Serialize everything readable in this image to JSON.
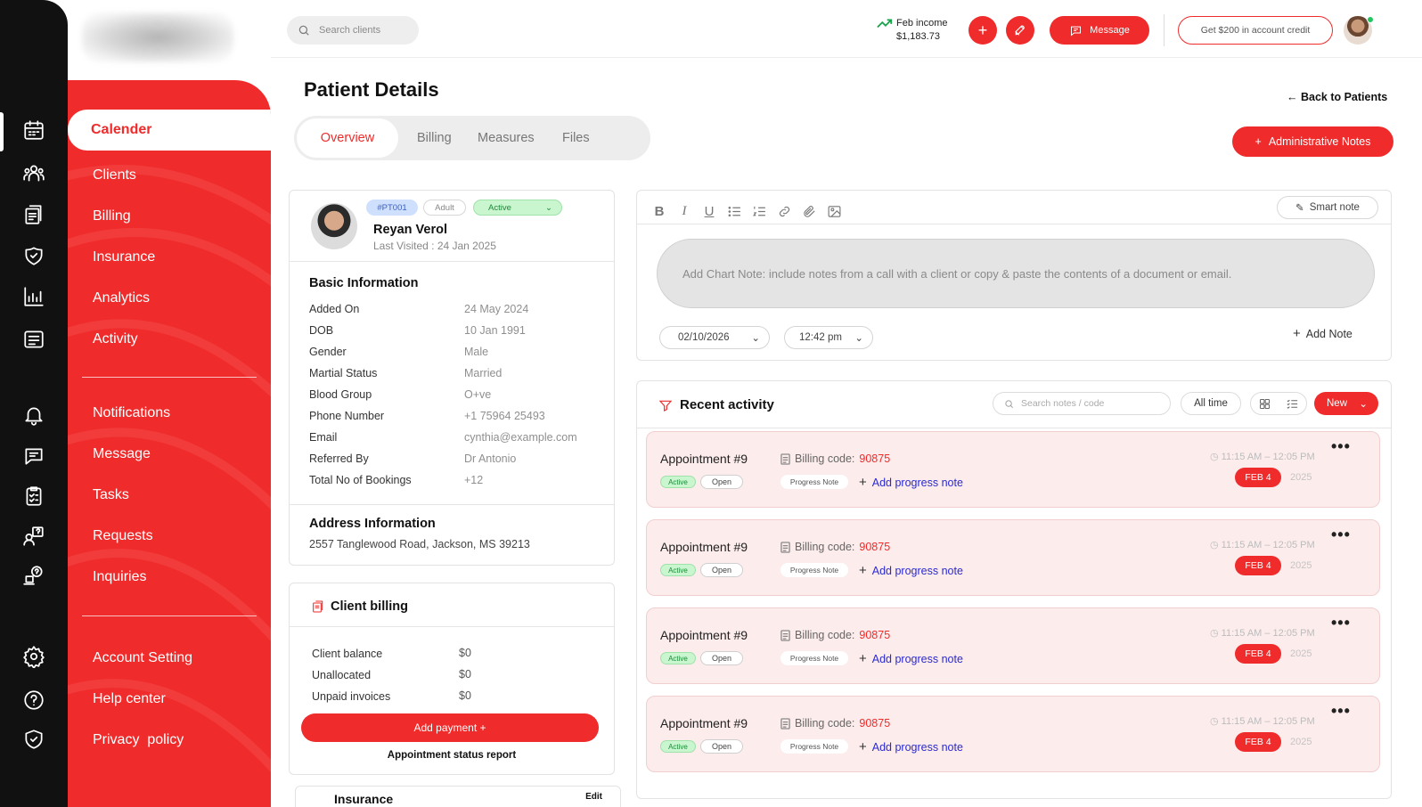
{
  "sidebar": {
    "items": [
      {
        "label": "Calender",
        "active": true
      },
      {
        "label": "Clients"
      },
      {
        "label": "Billing"
      },
      {
        "label": "Insurance"
      },
      {
        "label": "Analytics"
      },
      {
        "label": "Activity"
      },
      {
        "label": "Notifications"
      },
      {
        "label": "Message"
      },
      {
        "label": "Tasks"
      },
      {
        "label": "Requests"
      },
      {
        "label": "Inquiries"
      },
      {
        "label": "Account Setting"
      },
      {
        "label": "Help center"
      },
      {
        "label": "Privacy  policy"
      }
    ]
  },
  "header": {
    "search_placeholder": "Search clients",
    "income_label": "Feb income",
    "income_amount": "$1,183.73",
    "message_label": "Message",
    "credit_label": "Get $200 in account credit"
  },
  "page": {
    "title": "Patient Details",
    "back_label": "← Back to Patients",
    "admin_notes_label": "Administrative Notes",
    "tabs": [
      {
        "label": "Overview",
        "active": true
      },
      {
        "label": "Billing"
      },
      {
        "label": "Measures"
      },
      {
        "label": "Files"
      }
    ]
  },
  "patient": {
    "id_badge": "#PT001",
    "age_badge": "Adult",
    "status": "Active",
    "name": "Reyan Verol",
    "last_visited": "Last Visited : 24 Jan 2025",
    "basic_title": "Basic Information",
    "basic": [
      {
        "label": "Added On",
        "value": "24 May 2024"
      },
      {
        "label": "DOB",
        "value": "10 Jan 1991"
      },
      {
        "label": "Gender",
        "value": "Male"
      },
      {
        "label": "Martial Status",
        "value": "Married"
      },
      {
        "label": "Blood Group",
        "value": "O+ve"
      },
      {
        "label": "Phone Number",
        "value": "+1 75964 25493"
      },
      {
        "label": "Email",
        "value": "cynthia@example.com"
      },
      {
        "label": "Referred By",
        "value": "Dr Antonio"
      },
      {
        "label": "Total No of Bookings",
        "value": "+12"
      }
    ],
    "address_title": "Address Information",
    "address": "2557 Tanglewood Road, Jackson, MS 39213"
  },
  "billing": {
    "title": "Client billing",
    "rows": [
      {
        "label": "Client balance",
        "value": "$0"
      },
      {
        "label": "Unallocated",
        "value": "$0"
      },
      {
        "label": "Unpaid invoices",
        "value": "$0"
      }
    ],
    "add_payment_label": "Add payment  +",
    "status_report_label": "Appointment status report"
  },
  "insurance_peek": {
    "title": "Insurance",
    "edit": "Edit"
  },
  "note_editor": {
    "smart_note_label": "Smart note",
    "placeholder": "Add Chart Note: include notes from a call with a client or copy & paste the contents of a document or email.",
    "date": "02/10/2026",
    "time": "12:42 pm",
    "add_note_label": "Add Note"
  },
  "activity": {
    "title": "Recent activity",
    "search_placeholder": "Search notes / code",
    "range_label": "All time",
    "new_label": "New",
    "appointments": [
      {
        "title": "Appointment #9",
        "billing_prefix": "Billing code:",
        "billing_code": "90875",
        "status": "Active",
        "state": "Open",
        "note_tag": "Progress Note",
        "add_label": "Add progress note",
        "time": "11:15 AM – 12:05 PM",
        "date": "FEB 4",
        "year": "2025"
      },
      {
        "title": "Appointment #9",
        "billing_prefix": "Billing code:",
        "billing_code": "90875",
        "status": "Active",
        "state": "Open",
        "note_tag": "Progress Note",
        "add_label": "Add progress note",
        "time": "11:15 AM – 12:05 PM",
        "date": "FEB 4",
        "year": "2025"
      },
      {
        "title": "Appointment #9",
        "billing_prefix": "Billing code:",
        "billing_code": "90875",
        "status": "Active",
        "state": "Open",
        "note_tag": "Progress Note",
        "add_label": "Add progress note",
        "time": "11:15 AM – 12:05 PM",
        "date": "FEB 4",
        "year": "2025"
      },
      {
        "title": "Appointment #9",
        "billing_prefix": "Billing code:",
        "billing_code": "90875",
        "status": "Active",
        "state": "Open",
        "note_tag": "Progress Note",
        "add_label": "Add progress note",
        "time": "11:15 AM – 12:05 PM",
        "date": "FEB 4",
        "year": "2025"
      }
    ]
  },
  "colors": {
    "accent": "#ef2b2b",
    "rail": "#111111",
    "active_green": "#c9f5cf",
    "appointment_bg": "#fdecec"
  }
}
